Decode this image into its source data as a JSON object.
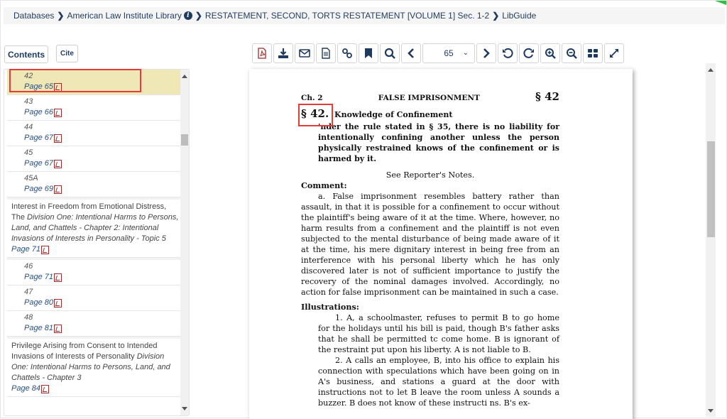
{
  "breadcrumb": {
    "items": [
      "Databases",
      "American Law Institute Library",
      "RESTATEMENT, SECOND, TORTS RESTATEMENT [VOLUME 1] Sec. 1-2",
      "LibGuide"
    ]
  },
  "buttons": {
    "contents": "Contents",
    "cite": "Cite"
  },
  "toc": {
    "items": [
      {
        "num": "42",
        "page": "Page 65",
        "active": true
      },
      {
        "num": "43",
        "page": "Page 66"
      },
      {
        "num": "44",
        "page": "Page 67"
      },
      {
        "num": "45",
        "page": "Page 67"
      },
      {
        "num": "45A",
        "page": "Page 69"
      }
    ],
    "group1": {
      "title": "Interest in Freedom from Emotional Distress, The",
      "subtitle": "Division One: Intentional Harms to Persons, Land, and Chattels - Chapter 2: Intentional Invasions of Interests in Personality - Topic 5",
      "page": "Page 71"
    },
    "items2": [
      {
        "num": "46",
        "page": "Page 71"
      },
      {
        "num": "47",
        "page": "Page 80"
      },
      {
        "num": "48",
        "page": "Page 81"
      }
    ],
    "group2": {
      "title": "Privilege Arising from Consent to Intended Invasions of Interests of Personality",
      "subtitle": "Division One: Intentional Harms to Persons, Land, and Chattels - Chapter 3",
      "page": "Page 84"
    }
  },
  "toolbar": {
    "page_value": "65",
    "icons": [
      "pdf-icon",
      "download-icon",
      "email-icon",
      "document-icon",
      "link-icon",
      "bookmark-icon",
      "search-icon",
      "prev-page-icon",
      "next-page-icon",
      "rotate-left-icon",
      "rotate-right-icon",
      "zoom-in-icon",
      "zoom-out-icon",
      "thumbnails-icon",
      "fullscreen-icon"
    ]
  },
  "document": {
    "chapter": "Ch. 2",
    "running_title": "FALSE IMPRISONMENT",
    "running_section": "§ 42",
    "section_num": "§ 42.",
    "section_title": "Knowledge of Confinement",
    "rule": "'nder the rule stated in § 35, there is no liability for intentionally confining another unless the person physically restrained knows of the confinement or is harmed by it.",
    "reporters_notes": "See Reporter's Notes.",
    "comment_label": "Comment:",
    "comment_a": "a. False imprisonment resembles battery rather than assault, in that it is possible for a confinement to occur without the plaintiff's being aware of it at the time. Where, however, no harm results from a confinement and the plaintiff is not even subjected to the mental disturbance of being made aware of it at the time, his mere dignitary interest in being free from an interference with his personal liberty which he has only discovered later is not of sufficient importance to justify the recovery of the nominal damages involved. Accordingly, no action for false imprisonment can be maintained in such a case.",
    "illustrations_label": "Illustrations:",
    "illustration_1": "1. A, a schoolmaster, refuses to permit B to go home for the holidays until his bill is paid, though B's father asks that he shall be permitted tc come home. B is ignorant of the restraint put upon his liberty. A is not liable to B.",
    "illustration_2": "2. A calls an employee, B, into his office to explain his connection with speculations which have been going on in A's business, and stations a guard at the door with instructions not to let B leave the room unless A sounds a buzzer. B does not know of these instructi ns. B's ex-"
  },
  "colors": {
    "accent": "#1f3a5f",
    "highlight": "#efe7b5",
    "annotation": "#e53b3b",
    "pdf": "#a32a2a"
  }
}
